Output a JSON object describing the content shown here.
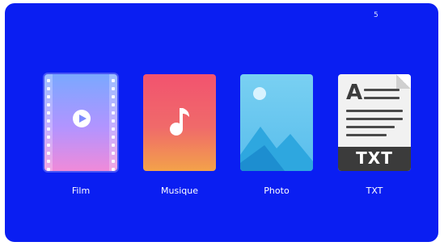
{
  "status": {
    "indicator": "5"
  },
  "menu": {
    "items": [
      {
        "label": "Film",
        "icon": "film-icon",
        "color": "#9b9bff"
      },
      {
        "label": "Musique",
        "icon": "music-note-icon",
        "color": "#f2536f"
      },
      {
        "label": "Photo",
        "icon": "photo-landscape-icon",
        "color": "#58bdec"
      },
      {
        "label": "TXT",
        "icon": "txt-document-icon",
        "color": "#3b3b3b",
        "badge": "TXT"
      }
    ]
  },
  "theme": {
    "background": "#0a1ef2"
  }
}
